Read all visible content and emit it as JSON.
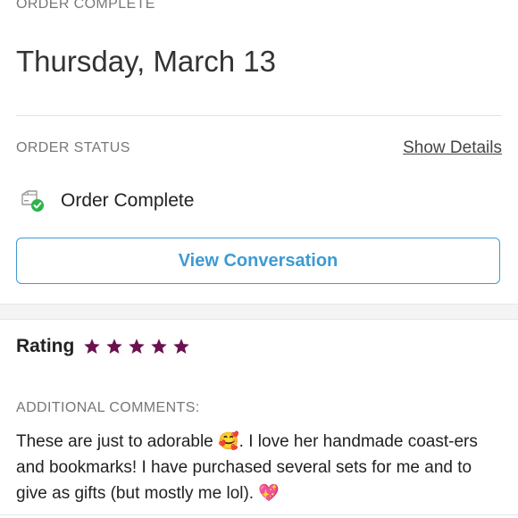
{
  "header": {
    "section_label": "ORDER COMPLETE",
    "date": "Thursday, March 13"
  },
  "order_status": {
    "label": "ORDER STATUS",
    "show_details": "Show Details",
    "status_text": "Order Complete",
    "status_icon": "package-check-icon",
    "view_button": "View Conversation",
    "accent_color": "#3d9bd3",
    "check_color": "#2db34a"
  },
  "review": {
    "rating_label": "Rating",
    "rating_value": 5,
    "rating_max": 5,
    "star_color": "#6b1150",
    "comments_label": "ADDITIONAL COMMENTS:",
    "comments_text": "These are just to adorable 🥰. I love her handmade coast-ers and bookmarks! I have purchased several sets for me and to give as gifts (but mostly me lol). 💖"
  }
}
